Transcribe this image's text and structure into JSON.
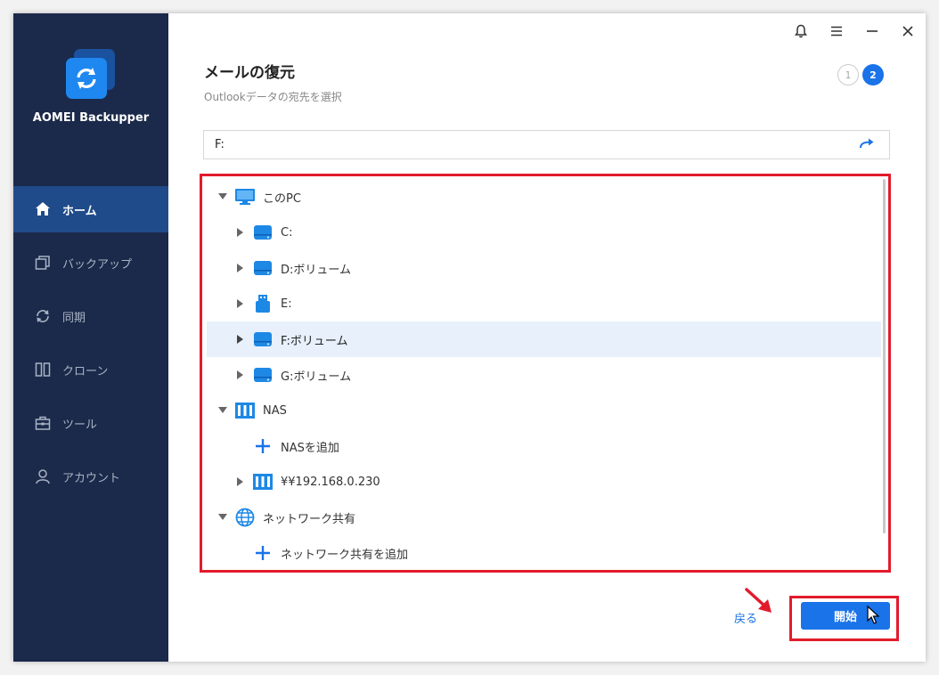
{
  "app": {
    "name": "AOMEI Backupper"
  },
  "nav": [
    {
      "label": "ホーム",
      "icon": "home-icon",
      "active": true
    },
    {
      "label": "バックアップ",
      "icon": "backup-icon",
      "active": false
    },
    {
      "label": "同期",
      "icon": "sync-icon",
      "active": false
    },
    {
      "label": "クローン",
      "icon": "clone-icon",
      "active": false
    },
    {
      "label": "ツール",
      "icon": "tools-icon",
      "active": false
    },
    {
      "label": "アカウント",
      "icon": "account-icon",
      "active": false
    }
  ],
  "page": {
    "title": "メールの復元",
    "subtitle": "Outlookデータの宛先を選択"
  },
  "steps": {
    "step1": "1",
    "step2": "2"
  },
  "path": {
    "value": "F:"
  },
  "tree": [
    {
      "label": "このPC",
      "icon": "monitor-icon",
      "arrow": "down",
      "indent": 0
    },
    {
      "label": "C:",
      "icon": "drive-icon",
      "arrow": "right",
      "indent": 1
    },
    {
      "label": "D:ボリューム",
      "icon": "drive-icon",
      "arrow": "right",
      "indent": 1
    },
    {
      "label": "E:",
      "icon": "usb-drive-icon",
      "arrow": "right",
      "indent": 1
    },
    {
      "label": "F:ボリューム",
      "icon": "drive-icon",
      "arrow": "right",
      "indent": 1,
      "selected": true
    },
    {
      "label": "G:ボリューム",
      "icon": "drive-icon",
      "arrow": "right",
      "indent": 1
    },
    {
      "label": "NAS",
      "icon": "nas-icon",
      "arrow": "down",
      "indent": 0
    },
    {
      "label": "NASを追加",
      "icon": "plus-icon",
      "arrow": "none",
      "indent": 1
    },
    {
      "label": "¥¥192.168.0.230",
      "icon": "nas-icon",
      "arrow": "right",
      "indent": 1
    },
    {
      "label": "ネットワーク共有",
      "icon": "globe-icon",
      "arrow": "down",
      "indent": 0
    },
    {
      "label": "ネットワーク共有を追加",
      "icon": "plus-icon",
      "arrow": "none",
      "indent": 1
    }
  ],
  "footer": {
    "back_label": "戻る",
    "start_label": "開始"
  },
  "colors": {
    "accent": "#1a73e8",
    "sidebar": "#1b2a4a",
    "annotation": "#e21b2c"
  }
}
